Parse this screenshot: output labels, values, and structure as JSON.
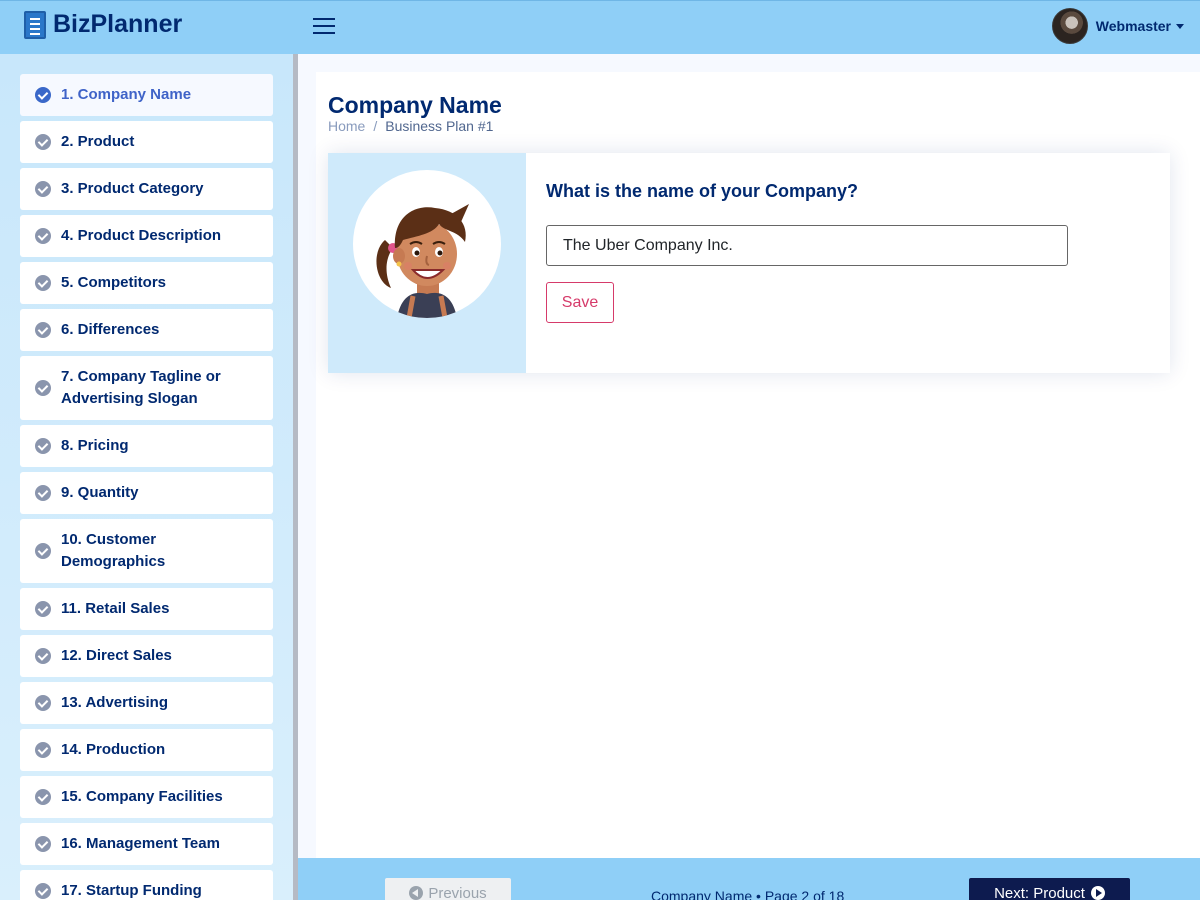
{
  "header": {
    "app_name": "BizPlanner",
    "logo_icon": "notebook-icon",
    "menu_icon": "hamburger-icon",
    "user_name": "Webmaster"
  },
  "sidebar": {
    "items": [
      {
        "label": "1. Company Name",
        "active": true
      },
      {
        "label": "2. Product"
      },
      {
        "label": "3. Product Category"
      },
      {
        "label": "4. Product Description"
      },
      {
        "label": "5. Competitors"
      },
      {
        "label": "6. Differences"
      },
      {
        "label": "7. Company Tagline or Advertising Slogan"
      },
      {
        "label": "8. Pricing"
      },
      {
        "label": "9. Quantity"
      },
      {
        "label": "10. Customer Demographics"
      },
      {
        "label": "11. Retail Sales"
      },
      {
        "label": "12. Direct Sales"
      },
      {
        "label": "13. Advertising"
      },
      {
        "label": "14. Production"
      },
      {
        "label": "15. Company Facilities"
      },
      {
        "label": "16. Management Team"
      },
      {
        "label": "17. Startup Funding"
      }
    ]
  },
  "main": {
    "title": "Company Name",
    "breadcrumb": {
      "home": "Home",
      "separator": "/",
      "current": "Business Plan #1"
    },
    "question": "What is the name of your Company?",
    "answer_value": "The Uber Company Inc.",
    "save_label": "Save"
  },
  "footer": {
    "prev_label": "Previous",
    "status": "Company Name • Page 2 of 18",
    "next_label": "Next: Product"
  },
  "colors": {
    "header_bg": "#8fcff7",
    "navy": "#012970",
    "save_accent": "#d63a6a",
    "next_bg": "#0d1b4f"
  }
}
